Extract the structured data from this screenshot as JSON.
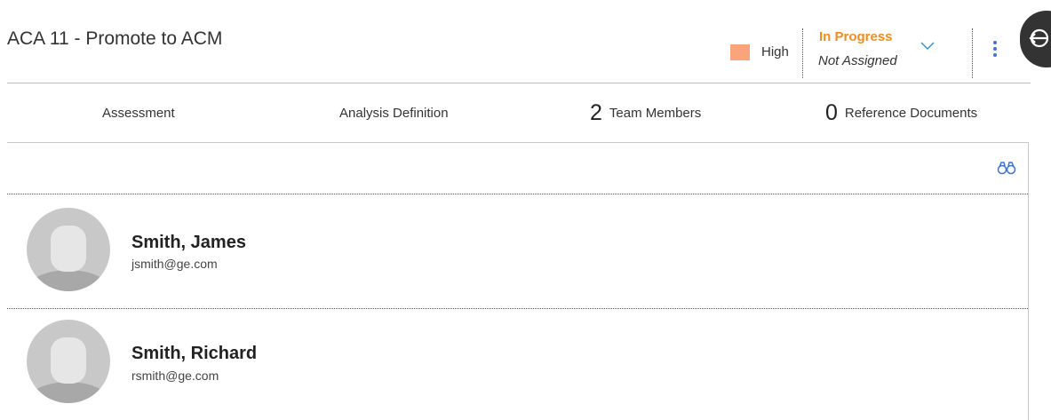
{
  "header": {
    "title": "ACA 11 - Promote to ACM",
    "priority": {
      "label": "High",
      "color": "#f9a47a"
    },
    "state": {
      "label": "In Progress",
      "color": "#f28c1a"
    },
    "assignee": "Not Assigned",
    "chevron_icon": "chevron-down-icon",
    "menu_icon": "kebab-menu-icon",
    "side_button_icon": "navigate-back-icon"
  },
  "tabs": [
    {
      "label": "Assessment",
      "count": ""
    },
    {
      "label": "Analysis Definition",
      "count": ""
    },
    {
      "label": "Team Members",
      "count": "2"
    },
    {
      "label": "Reference Documents",
      "count": "0"
    }
  ],
  "toolbar": {
    "search_icon": "binoculars-icon"
  },
  "members": [
    {
      "name": "Smith, James",
      "email": "jsmith@ge.com"
    },
    {
      "name": "Smith, Richard",
      "email": "rsmith@ge.com"
    }
  ],
  "colors": {
    "accent": "#3b73d6",
    "chevron": "#2f8fd4",
    "kebab": "#3b73d6"
  }
}
